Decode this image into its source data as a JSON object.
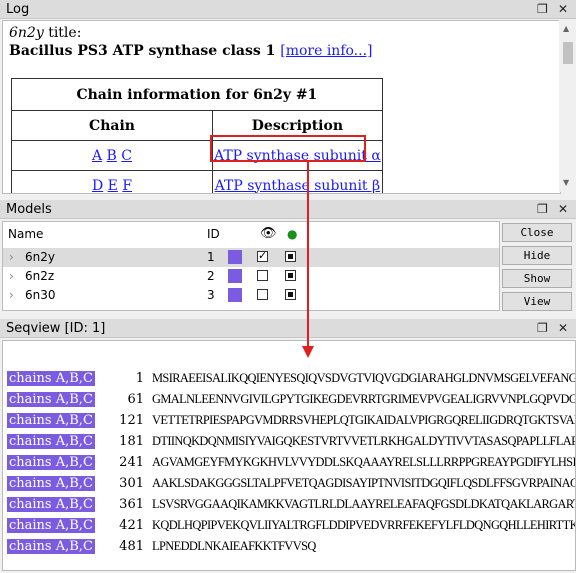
{
  "log": {
    "panel_title": "Log",
    "title_prefix": "6n2y",
    "title_suffix": " title:",
    "heading": "Bacillus PS3 ATP synthase class 1",
    "more_info": "[more info...]",
    "table_caption": "Chain information for 6n2y #1",
    "col_chain": "Chain",
    "col_desc": "Description",
    "rows": [
      {
        "chains": [
          "A",
          "B",
          "C"
        ],
        "description": "ATP synthase subunit α"
      },
      {
        "chains": [
          "D",
          "E",
          "F"
        ],
        "description": "ATP synthase subunit β"
      }
    ]
  },
  "models": {
    "panel_title": "Models",
    "columns": {
      "name": "Name",
      "id": "ID"
    },
    "rows": [
      {
        "name": "6n2y",
        "id": "1",
        "shown": true,
        "selected": true
      },
      {
        "name": "6n2z",
        "id": "2",
        "shown": false,
        "selected": false
      },
      {
        "name": "6n30",
        "id": "3",
        "shown": false,
        "selected": false
      }
    ],
    "buttons": {
      "close": "Close",
      "hide": "Hide",
      "show": "Show",
      "view": "View"
    },
    "swatch_color": "#7b5ce0"
  },
  "seqview": {
    "panel_title": "Seqview [ID: 1]",
    "chain_label": "chains A,B,C",
    "rows": [
      {
        "start": "1",
        "seq": "MSIRAEEISALIKQQIENYESQIQVSDVGTVIQVGDGIARAHGLDNVMSGELVEFANGVM"
      },
      {
        "start": "61",
        "seq": "GMALNLEENNVGIVILGPYTGIKEGDEVRRTGRIMEVPVGEALIGRVVNPLGQPVDGLGP"
      },
      {
        "start": "121",
        "seq": "VETTETRPIESPAPGVMDRRSVHEPLQTGIKAIDALVPIGRGQRELIIGDRQTGKTSVAI"
      },
      {
        "start": "181",
        "seq": "DTIINQKDQNMISIYVAIGQKESTVRTVVETLRKHGALDYTIVVTASASQPAPLLFLAPY"
      },
      {
        "start": "241",
        "seq": "AGVAMGEYFMYKGKHVLVVYDDLSKQAAAYRELSLLLRRPPGREAYPGDIFYLHSRLLER"
      },
      {
        "start": "301",
        "seq": "AAKLSDAKGGGSLTALPFVETQAGDISAYIPTNVISITDGQIFLQSDLFFSGVRPAINAG"
      },
      {
        "start": "361",
        "seq": "LSVSRVGGAAQIKAMKKVAGTLRLDLAAYRELEAFAQFGSDLDKATQAKLARGARTVEVL"
      },
      {
        "start": "421",
        "seq": "KQDLHQPIPVEKQVLIIYALTRGFLDDIPVEDVRRFEKEFYLFLDQNGQHLLEHIRTTKD"
      },
      {
        "start": "481",
        "seq": "LPNEDDLNKAIEAFKKTFVVSQ"
      }
    ]
  },
  "accent_colors": {
    "chain_chip": "#7b5ce0",
    "callout": "#e02020",
    "link": "#1a1aff"
  }
}
